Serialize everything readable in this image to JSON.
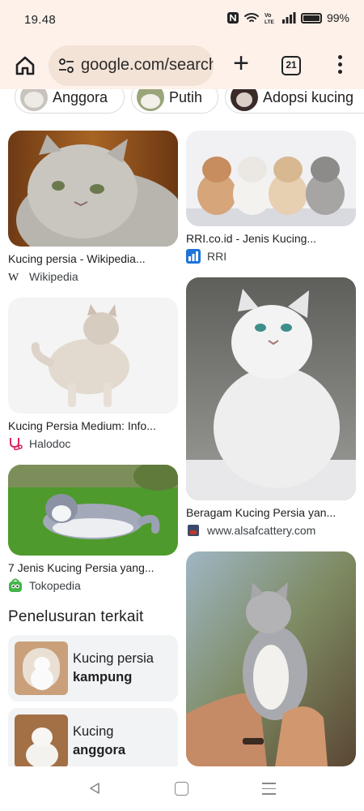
{
  "status": {
    "time": "19.48",
    "battery": "99%",
    "icons": [
      "nfc-icon",
      "wifi-icon",
      "volte-icon",
      "signal-icon",
      "battery-icon"
    ]
  },
  "toolbar": {
    "url": "google.com/search",
    "tab_count": "21"
  },
  "chips": [
    {
      "label": "Anggora"
    },
    {
      "label": "Putih"
    },
    {
      "label": "Adopsi kucing"
    }
  ],
  "results": {
    "r1": {
      "title": "Kucing persia - Wikipedia...",
      "source": "Wikipedia"
    },
    "r2": {
      "title": "RRI.co.id - Jenis Kucing...",
      "source": "RRI"
    },
    "r3": {
      "title": "Kucing Persia Medium: Info...",
      "source": "Halodoc"
    },
    "r4": {
      "title": "Beragam Kucing Persia yan...",
      "source": "www.alsafcattery.com"
    },
    "r5": {
      "title": "7 Jenis Kucing Persia yang...",
      "source": "Tokopedia"
    }
  },
  "related": {
    "heading": "Penelusuran terkait",
    "items": [
      {
        "line1": "Kucing persia",
        "line2": "kampung"
      },
      {
        "line1": "Kucing",
        "line2": "anggora"
      }
    ]
  },
  "colors": {
    "chrome_bg": "#fdf1ea",
    "url_pill": "#f3e2d6",
    "card_bg": "#f1f3f4"
  }
}
